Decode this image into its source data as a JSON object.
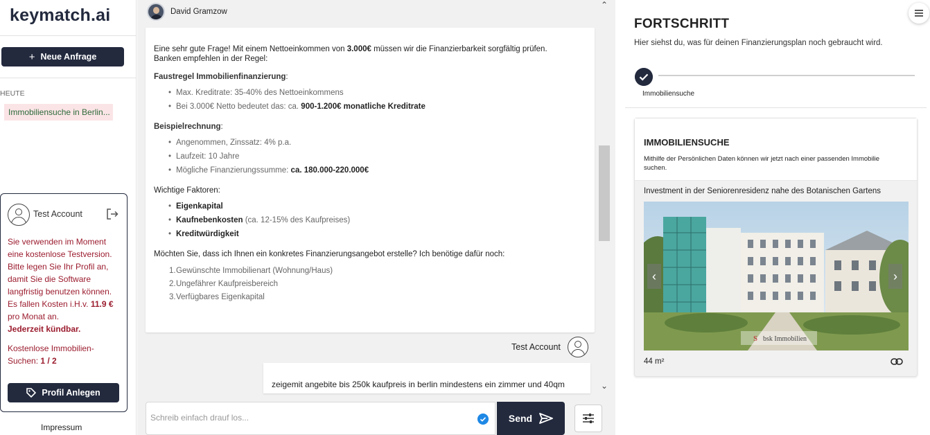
{
  "sidebar": {
    "logo": "keymatch.ai",
    "new_request_label": "Neue Anfrage",
    "today_label": "HEUTE",
    "history": [
      {
        "label": "Immobiliensuche in Berlin..."
      }
    ],
    "account": {
      "name": "Test Account",
      "trial_text_1": "Sie verwenden im Moment eine kostenlose Testversion. Bitte legen Sie Ihr Profil an, damit Sie die Software langfristig benutzen können. Es fallen Kosten i.H.v. ",
      "price": "11.9 €",
      "trial_text_2": " pro Monat an.",
      "cancel_note": "Jederzeit kündbar.",
      "quota_label": "Kostenlose Immobilien-Suchen: ",
      "quota_value": "1 / 2",
      "profile_button": "Profil Anlegen"
    },
    "impressum": "Impressum"
  },
  "chat": {
    "bot_name": "David Gramzow",
    "bot_message": {
      "intro_1": "Eine sehr gute Frage! Mit einem Nettoeinkommen von ",
      "intro_income": "3.000€",
      "intro_2": " müssen wir die Finanzierbarkeit sorgfältig prüfen.",
      "intro_3": "Banken empfehlen in der Regel:",
      "rule_heading": "Faustregel Immobilienfinanzierung",
      "rule_items": [
        {
          "text": "Max. Kreditrate: 35-40% des Nettoeinkommens",
          "bold": ""
        },
        {
          "text": "Bei 3.000€ Netto bedeutet das: ca. ",
          "bold": "900-1.200€ monatliche Kreditrate"
        }
      ],
      "example_heading": "Beispielrechnung",
      "example_items": [
        {
          "text": "Angenommen, Zinssatz: 4% p.a.",
          "bold": ""
        },
        {
          "text": "Laufzeit: 10 Jahre",
          "bold": ""
        },
        {
          "text": "Mögliche Finanzierungssumme: ",
          "bold": "ca. 180.000-220.000€"
        }
      ],
      "factors_heading": "Wichtige Faktoren:",
      "factors": [
        {
          "bold": "Eigenkapital",
          "text": ""
        },
        {
          "bold": "Kaufnebenkosten",
          "text": " (ca. 12-15% des Kaufpreises)"
        },
        {
          "bold": "Kreditwürdigkeit",
          "text": ""
        }
      ],
      "question": "Möchten Sie, dass ich Ihnen ein konkretes Finanzierungsangebot erstelle? Ich benötige dafür noch:",
      "needs": [
        {
          "n": "1.",
          "text": "Gewünschte Immobilienart (Wohnung/Haus)"
        },
        {
          "n": "2.",
          "text": "Ungefährer Kaufpreisbereich"
        },
        {
          "n": "3.",
          "text": "Verfügbares Eigenkapital"
        }
      ]
    },
    "user_name": "Test Account",
    "user_message": "zeigemit angebite bis 250k kaufpreis in berlin mindestens ein zimmer und 40qm",
    "input_placeholder": "Schreib einfach drauf los...",
    "send_label": "Send"
  },
  "progress": {
    "title": "FORTSCHRITT",
    "subtitle": "Hier siehst du, was für deinen Finanzierungsplan noch gebraucht wird.",
    "step_label": "Immobiliensuche",
    "card": {
      "title": "IMMOBILIENSUCHE",
      "description": "Mithilfe der Persönlichen Daten können wir jetzt nach einer passenden Immobilie suchen.",
      "listing_title": "Investment in der Seniorenresidenz nahe des Botanischen Gartens",
      "watermark": "bsk Immobilien",
      "area": "44 m²"
    }
  },
  "colors": {
    "brand": "#232a3e",
    "alert": "#9b1c2e",
    "history_bg": "#fbe4e6",
    "check": "#1e88e5"
  }
}
